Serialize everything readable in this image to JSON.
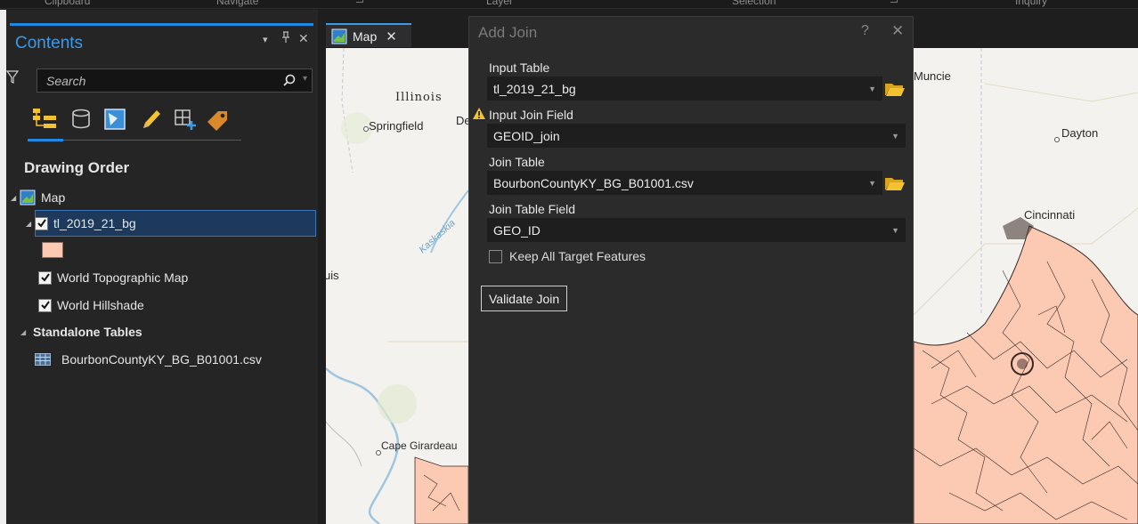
{
  "ribbon": {
    "groups": [
      "Clipboard",
      "Navigate",
      "Layer",
      "Selection",
      "Inquiry"
    ]
  },
  "contents": {
    "title": "Contents",
    "controls": {
      "menu": "▾",
      "pin": "⊓",
      "close": "✕"
    },
    "search": {
      "placeholder": "Search",
      "value": ""
    },
    "toolbar_icons": [
      "list-by-drawing-order-icon",
      "list-by-data-source-icon",
      "list-by-selection-icon",
      "list-by-editing-icon",
      "list-by-snapping-icon",
      "list-by-labeling-icon"
    ],
    "section": "Drawing Order",
    "tree": {
      "map": "Map",
      "layer": "tl_2019_21_bg",
      "basemap1": "World Topographic Map",
      "basemap2": "World Hillshade",
      "standalone_header": "Standalone Tables",
      "table": "BourbonCountyKY_BG_B01001.csv"
    }
  },
  "map_tab": {
    "label": "Map",
    "close": "✕"
  },
  "map": {
    "labels": {
      "illinois": "Illinois",
      "springfield": "Springfield",
      "de": "De",
      "kaskaskia": "Kaskaskia",
      "uis": "uis",
      "cape_girardeau": "Cape Girardeau",
      "muncie": "Muncie",
      "dayton": "Dayton",
      "cincinnati": "Cincinnati"
    },
    "colors": {
      "polygon_fill": "#fcc9b3",
      "polygon_stroke": "#3a2a25"
    }
  },
  "dialog": {
    "title": "Add Join",
    "help": "?",
    "close": "✕",
    "input_table_label": "Input Table",
    "input_table_value": "tl_2019_21_bg",
    "input_join_field_label": "Input Join Field",
    "input_join_field_value": "GEOID_join",
    "join_table_label": "Join Table",
    "join_table_value": "BourbonCountyKY_BG_B01001.csv",
    "join_table_field_label": "Join Table Field",
    "join_table_field_value": "GEO_ID",
    "keep_all_label": "Keep All Target Features",
    "keep_all_checked": false,
    "validate_label": "Validate Join"
  }
}
